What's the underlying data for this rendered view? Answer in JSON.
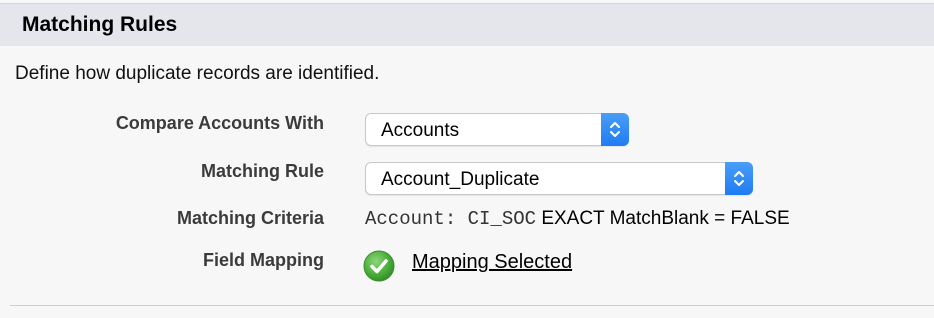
{
  "section": {
    "title": "Matching Rules",
    "description": "Define how duplicate records are identified."
  },
  "fields": {
    "compare_with": {
      "label": "Compare Accounts With",
      "value": "Accounts"
    },
    "matching_rule": {
      "label": "Matching Rule",
      "value": "Account_Duplicate"
    },
    "matching_criteria": {
      "label": "Matching Criteria",
      "field_text": "Account: CI_SOC",
      "operator_text": "EXACT",
      "blank_text": "MatchBlank = FALSE"
    },
    "field_mapping": {
      "label": "Field Mapping",
      "link_text": "Mapping Selected",
      "icon": "check-circle-icon"
    }
  },
  "colors": {
    "header_bg": "#e5e6ec",
    "page_bg": "#f7f7f7",
    "select_arrow": "#1f7cf2",
    "check_green": "#4cae3c"
  }
}
